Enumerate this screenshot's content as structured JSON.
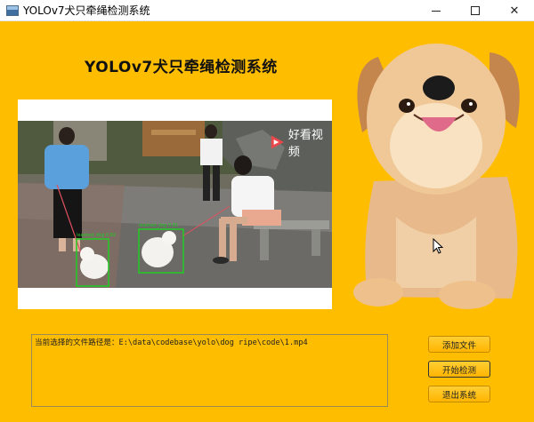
{
  "window": {
    "title": "YOLOv7犬只牵绳检测系统",
    "controls": {
      "minimize": "—",
      "maximize": "☐",
      "close": "✕"
    }
  },
  "app": {
    "heading": "YOLOv7犬只牵绳检测系统"
  },
  "video": {
    "watermark": "好看视频",
    "detections": [
      {
        "label": "leashed_dog 0.82"
      },
      {
        "label": "leashed_dog 0.81"
      }
    ]
  },
  "path_panel": {
    "text": "当前选择的文件路径是：E:\\data\\codebase\\yolo\\dog ripe\\code\\1.mp4"
  },
  "buttons": {
    "add_file": "添加文件",
    "start_detect": "开始检测",
    "exit_system": "退出系统"
  },
  "colors": {
    "background": "#ffbd00",
    "detection_box": "#22cc22",
    "watermark_accent": "#e8474c"
  }
}
